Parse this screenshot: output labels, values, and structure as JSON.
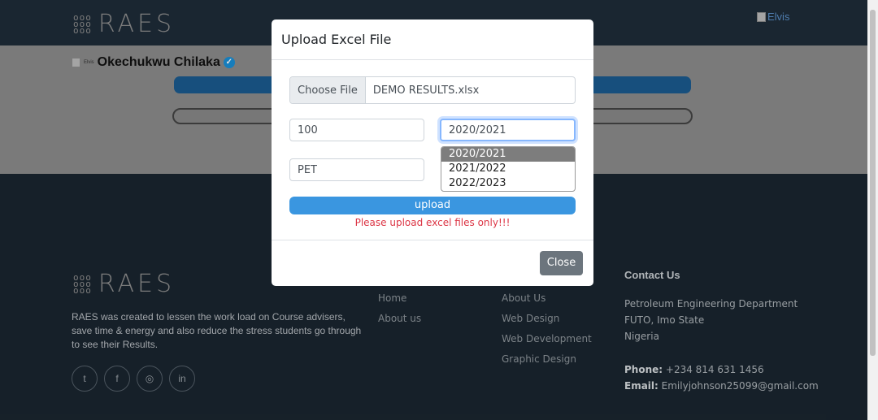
{
  "nav": {
    "logo_text": "RAES",
    "avatar_alt": "Elvis"
  },
  "profile": {
    "image_alt": "Elvis",
    "name": "Okechukwu Chilaka"
  },
  "modal": {
    "title": "Upload Excel File",
    "file_button": "Choose File",
    "file_name": "DEMO RESULTS.xlsx",
    "level_value": "100",
    "session_value": "2020/2021",
    "session_options": [
      "2020/2021",
      "2021/2022",
      "2022/2023"
    ],
    "course_value": "PET",
    "upload_label": "upload",
    "error_text": "Please upload excel files only!!!",
    "close_label": "Close"
  },
  "footer": {
    "logo_text": "RAES",
    "description": "RAES was created to lessen the work load on Course advisers, save time & energy and also reduce the stress students go through to see their Results.",
    "links_col1": [
      "Home",
      "About us"
    ],
    "links_col2": [
      "About Us",
      "Web Design",
      "Web Development",
      "Graphic Design"
    ],
    "contact_heading": "Contact Us",
    "address_line1": "Petroleum Engineering Department",
    "address_line2": "FUTO, Imo State",
    "address_line3": "Nigeria",
    "phone_label": "Phone:",
    "phone": "+234 814 631 1456",
    "email_label": "Email:",
    "email": "Emilyjohnson25099@gmail.com",
    "socials": [
      "twitter-icon",
      "facebook-icon",
      "instagram-icon",
      "linkedin-icon"
    ]
  },
  "colors": {
    "topbar": "#1e2c38",
    "footer": "#1a252f",
    "upload": "#3a96e0",
    "error": "#dc3545",
    "close": "#6c757d"
  }
}
